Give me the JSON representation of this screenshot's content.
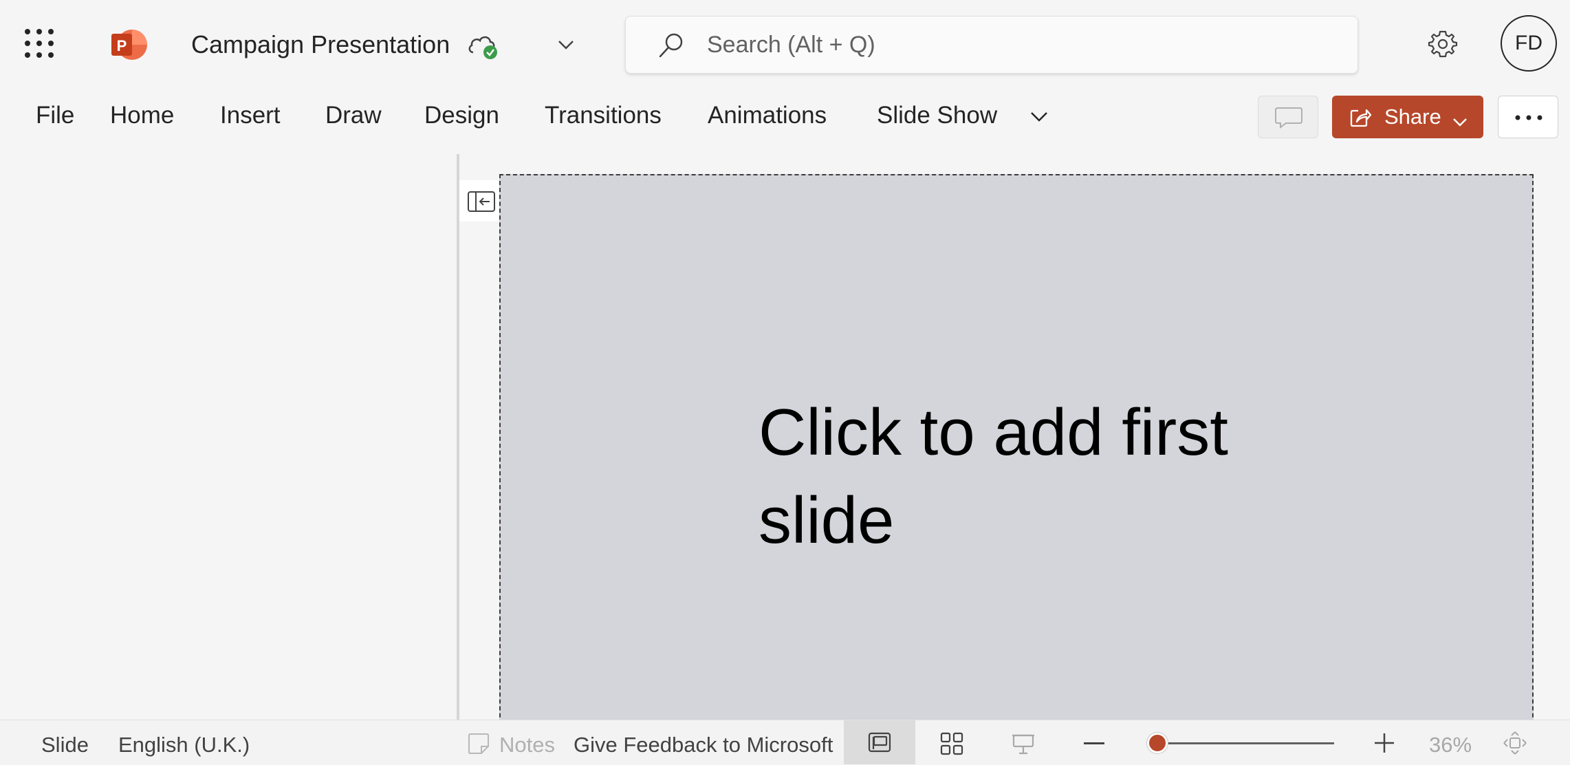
{
  "app": {
    "document_title": "Campaign Presentation",
    "search_placeholder": "Search (Alt + Q)",
    "user_initials": "FD",
    "accent_color": "#b7472a"
  },
  "ribbon": {
    "tabs": [
      "File",
      "Home",
      "Insert",
      "Draw",
      "Design",
      "Transitions",
      "Animations",
      "Slide Show"
    ],
    "share_label": "Share"
  },
  "slide": {
    "title_placeholder": "Click to add first slide"
  },
  "statusbar": {
    "slide_label": "Slide",
    "language": "English (U.K.)",
    "notes_label": "Notes",
    "feedback_label": "Give Feedback to Microsoft",
    "zoom_percent": "36%"
  }
}
